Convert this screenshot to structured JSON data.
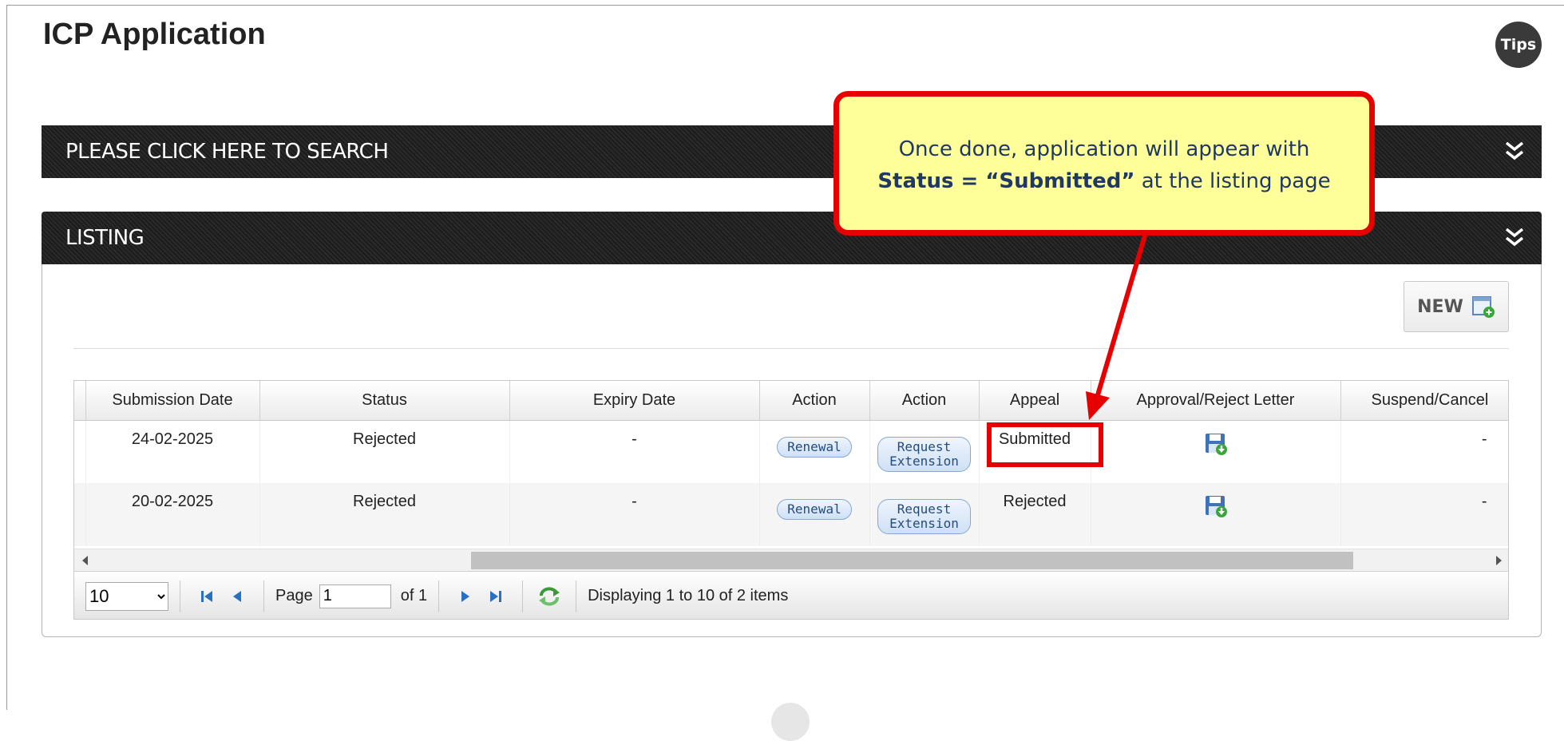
{
  "page": {
    "title": "ICP Application",
    "tips_label": "Tips"
  },
  "search_panel": {
    "title": "PLEASE CLICK HERE TO SEARCH"
  },
  "listing_panel": {
    "title": "LISTING",
    "new_button": "NEW"
  },
  "table": {
    "columns": [
      "Submission Date",
      "Status",
      "Expiry Date",
      "Action",
      "Action",
      "Appeal",
      "Approval/Reject Letter",
      "Suspend/Cancel"
    ],
    "rows": [
      {
        "submission_date": "24-02-2025",
        "status": "Rejected",
        "expiry_date": "-",
        "action1": "Renewal",
        "action2_line1": "Request",
        "action2_line2": "Extension",
        "appeal": "Submitted",
        "letter_icon": "save-download-icon",
        "suspend_cancel": "-"
      },
      {
        "submission_date": "20-02-2025",
        "status": "Rejected",
        "expiry_date": "-",
        "action1": "Renewal",
        "action2_line1": "Request",
        "action2_line2": "Extension",
        "appeal": "Rejected",
        "letter_icon": "save-download-icon",
        "suspend_cancel": "-"
      }
    ]
  },
  "pager": {
    "page_size": "10",
    "page_size_options": [
      "10"
    ],
    "page_label": "Page",
    "page_value": "1",
    "of_label": "of 1",
    "display_text": "Displaying 1 to 10 of 2 items"
  },
  "callout": {
    "line1": "Once done, application will appear with",
    "line2_bold": "Status = “Submitted”",
    "line2_rest": " at the listing page"
  },
  "colors": {
    "annotation_red": "#e60000",
    "callout_fill": "#ffff99",
    "callout_text": "#1f3864",
    "header_bar": "#222222"
  }
}
